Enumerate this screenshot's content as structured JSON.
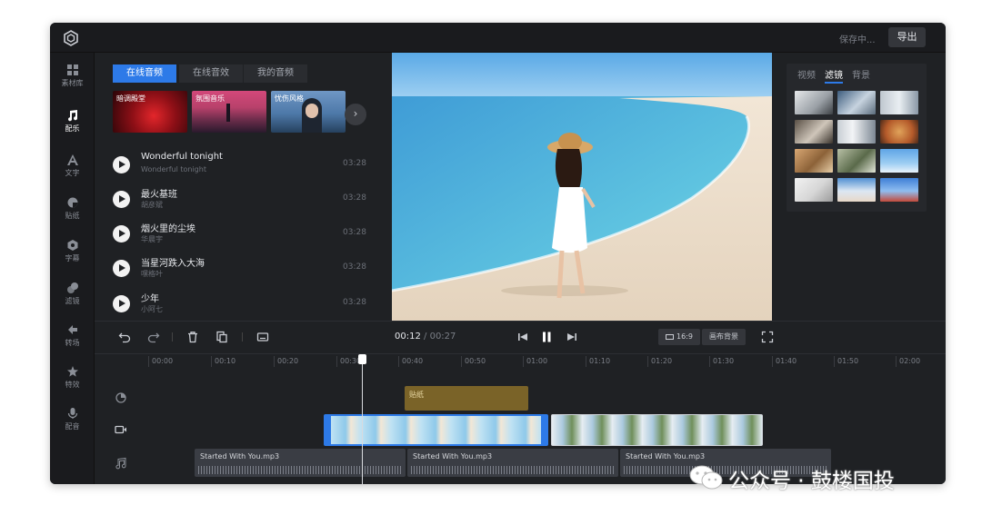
{
  "header": {
    "saving_status": "保存中...",
    "export_label": "导出"
  },
  "rail": {
    "items": [
      {
        "label": "素材库",
        "icon": "grid-icon"
      },
      {
        "label": "配乐",
        "icon": "music-note-icon"
      },
      {
        "label": "文字",
        "icon": "text-icon"
      },
      {
        "label": "贴纸",
        "icon": "sticker-icon"
      },
      {
        "label": "字幕",
        "icon": "subtitle-icon"
      },
      {
        "label": "滤镜",
        "icon": "filter-icon"
      },
      {
        "label": "转场",
        "icon": "transition-icon"
      },
      {
        "label": "特效",
        "icon": "effects-icon"
      },
      {
        "label": "配音",
        "icon": "microphone-icon"
      }
    ],
    "active_index": 1
  },
  "music": {
    "tabs": [
      "在线音频",
      "在线音效",
      "我的音频"
    ],
    "active_tab": 0,
    "categories": [
      "暗调殿堂",
      "氛围音乐",
      "忧伤风格"
    ],
    "songs": [
      {
        "name": "Wonderful tonight",
        "artist": "Wonderful tonight",
        "duration": "03:28"
      },
      {
        "name": "最火基班",
        "artist": "胡彦斌",
        "duration": "03:28"
      },
      {
        "name": "烟火里的尘埃",
        "artist": "华晨宇",
        "duration": "03:28"
      },
      {
        "name": "当星河跌入大海",
        "artist": "嘿格叶",
        "duration": "03:28"
      },
      {
        "name": "少年",
        "artist": "小阿七",
        "duration": "03:28"
      }
    ]
  },
  "filters_panel": {
    "tabs": [
      "视频",
      "滤镜",
      "背景"
    ],
    "active_tab": 1
  },
  "playback": {
    "current_time": "00:12",
    "separator": "/",
    "total_time": "00:27",
    "ratio_label": "16:9",
    "canvas_bg_label": "画布背景"
  },
  "timeline": {
    "ticks": [
      "00:00",
      "00:10",
      "00:20",
      "00:30",
      "00:40",
      "00:50",
      "01:00",
      "01:10",
      "01:20",
      "01:30",
      "01:40",
      "01:50",
      "02:00"
    ],
    "sticker_clip_label": "贴纸",
    "audio_clips": [
      "Started With You.mp3",
      "Started With You.mp3",
      "Started With You.mp3"
    ]
  },
  "watermark": {
    "text": "公众号 · 鼓楼国投"
  },
  "colors": {
    "accent": "#2d7ae8",
    "panel": "#1f2124",
    "sticker": "#7a6328"
  }
}
